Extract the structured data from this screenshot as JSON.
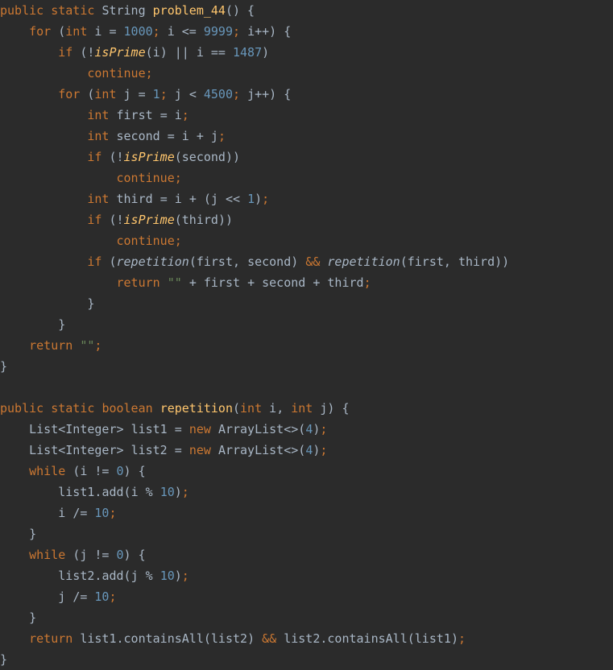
{
  "editor": {
    "language": "java",
    "theme": "darcula",
    "background_color": "#2b2b2b",
    "font_size_px": 15,
    "line_height_px": 26,
    "colors": {
      "keyword": "#cc7832",
      "identifier": "#a9b7c6",
      "number": "#6897bb",
      "string": "#6a8759",
      "method_declaration": "#ffc66d",
      "static_call": "#ffc66d",
      "background": "#2b2b2b"
    }
  },
  "code": {
    "lines": [
      "public static String problem_44() {",
      "    for (int i = 1000; i <= 9999; i++) {",
      "        if (!isPrime(i) || i == 1487)",
      "            continue;",
      "        for (int j = 1; j < 4500; j++) {",
      "            int first = i;",
      "            int second = i + j;",
      "            if (!isPrime(second))",
      "                continue;",
      "            int third = i + (j << 1);",
      "            if (!isPrime(third))",
      "                continue;",
      "            if (repetition(first, second) && repetition(first, third))",
      "                return \"\" + first + second + third;",
      "        }",
      "    }",
      "    return \"\";",
      "}",
      "",
      "public static boolean repetition(int i, int j) {",
      "    List<Integer> list1 = new ArrayList<>(4);",
      "    List<Integer> list2 = new ArrayList<>(4);",
      "    while (i != 0) {",
      "        list1.add(i % 10);",
      "        i /= 10;",
      "    }",
      "    while (j != 0) {",
      "        list2.add(j % 10);",
      "        j /= 10;",
      "    }",
      "    return list1.containsAll(list2) && list2.containsAll(list1);",
      "}"
    ],
    "method_names": [
      "problem_44",
      "repetition"
    ],
    "called_methods": [
      "isPrime",
      "repetition",
      "add",
      "containsAll"
    ],
    "types": [
      "String",
      "boolean",
      "int",
      "List<Integer>",
      "ArrayList<>",
      "Integer"
    ],
    "numbers": [
      "1000",
      "9999",
      "1487",
      "1",
      "4500",
      "1",
      "4",
      "4",
      "0",
      "10",
      "10",
      "0",
      "10",
      "10"
    ],
    "strings": [
      "\"\"",
      "\"\""
    ],
    "keywords": [
      "public",
      "static",
      "for",
      "if",
      "continue",
      "int",
      "return",
      "boolean",
      "new",
      "while"
    ]
  }
}
